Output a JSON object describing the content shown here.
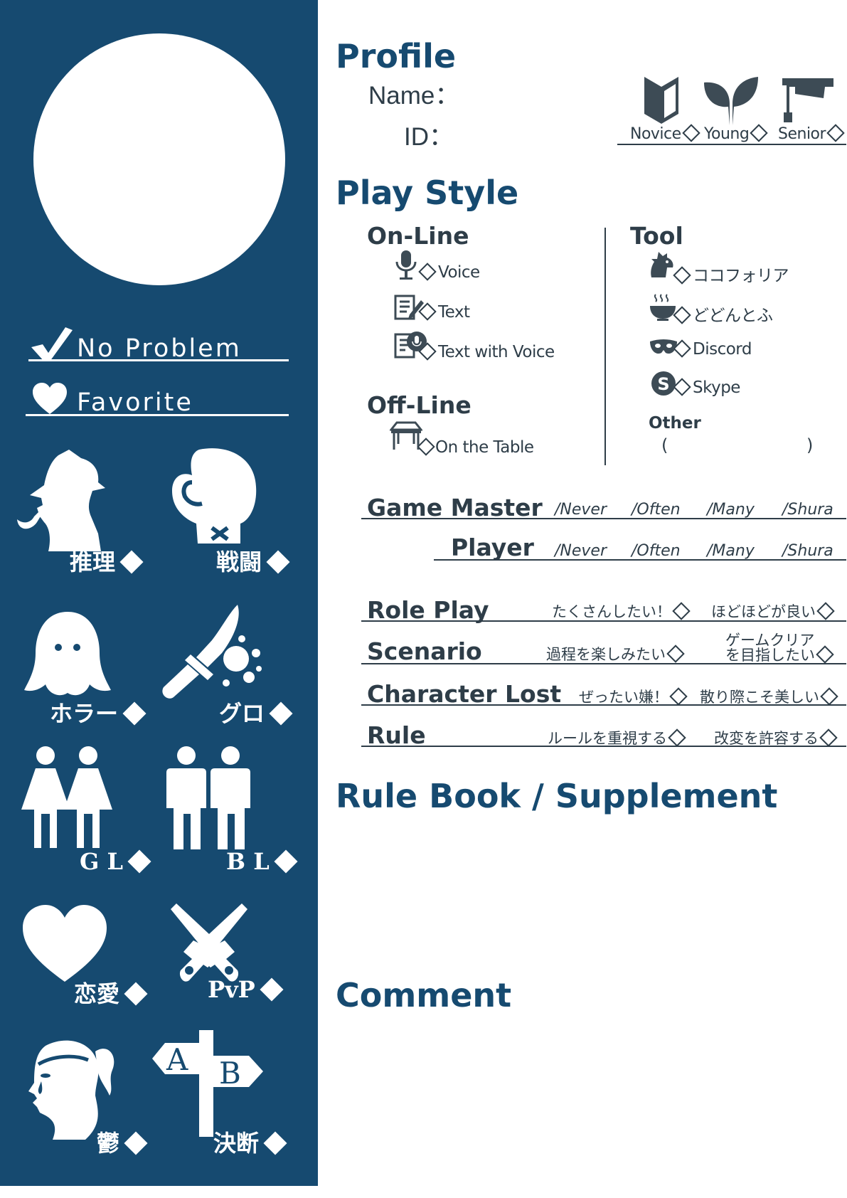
{
  "sidebar": {
    "no_problem": "No Problem",
    "favorite": "Favorite",
    "genres": [
      {
        "label": "推理",
        "icon": "detective-icon"
      },
      {
        "label": "戦闘",
        "icon": "boxing-glove-icon"
      },
      {
        "label": "ホラー",
        "icon": "ghost-icon"
      },
      {
        "label": "グロ",
        "icon": "bloody-knife-icon"
      },
      {
        "label": "G L",
        "icon": "two-women-icon"
      },
      {
        "label": "B L",
        "icon": "two-men-icon"
      },
      {
        "label": "恋愛",
        "icon": "heart-icon"
      },
      {
        "label": "PvP",
        "icon": "crossed-pistols-icon"
      },
      {
        "label": "鬱",
        "icon": "crying-woman-icon"
      },
      {
        "label": "決断",
        "icon": "signpost-icon"
      }
    ],
    "signpost_a": "A",
    "signpost_b": "B"
  },
  "profile": {
    "heading": "Profile",
    "name_label": "Name：",
    "id_label": "ID：",
    "levels": [
      {
        "label": "Novice",
        "icon": "beginner-mark-icon"
      },
      {
        "label": "Young",
        "icon": "sprout-icon"
      },
      {
        "label": "Senior",
        "icon": "graduation-cap-icon"
      }
    ]
  },
  "play_style": {
    "heading": "Play Style",
    "online_heading": "On-Line",
    "online_options": [
      {
        "label": "Voice",
        "icon": "microphone-icon"
      },
      {
        "label": "Text",
        "icon": "notepad-icon"
      },
      {
        "label": "Text with Voice",
        "icon": "notepad-mic-icon"
      }
    ],
    "offline_heading": "Off-Line",
    "offline_options": [
      {
        "label": "On the Table",
        "icon": "table-icon"
      }
    ],
    "tool_heading": "Tool",
    "tools": [
      {
        "label": "ココフォリア",
        "icon": "cockatoo-icon"
      },
      {
        "label": "どどんとふ",
        "icon": "rice-bowl-icon"
      },
      {
        "label": "Discord",
        "icon": "discord-icon"
      },
      {
        "label": "Skype",
        "icon": "skype-icon"
      }
    ],
    "other_label": "Other",
    "other_open": "(",
    "other_close": ")"
  },
  "frequency": {
    "scale": [
      "/Never",
      "/Often",
      "/Many",
      "/Shura"
    ],
    "rows": [
      {
        "label": "Game Master"
      },
      {
        "label": "Player"
      }
    ]
  },
  "preferences": [
    {
      "label": "Role Play",
      "left": "たくさんしたい！",
      "right": "ほどほどが良い"
    },
    {
      "label": "Scenario",
      "left": "過程を楽しみたい",
      "right_line1": "ゲームクリア",
      "right_line2": "を目指したい"
    },
    {
      "label": "Character Lost",
      "left": "ぜったい嫌！",
      "right": "散り際こそ美しい"
    },
    {
      "label": "Rule",
      "left": "ルールを重視する",
      "right": "改変を許容する"
    }
  ],
  "rulebook_heading": "Rule Book / Supplement",
  "comment_heading": "Comment",
  "colors": {
    "navy": "#164a70",
    "text": "#2e3d48",
    "white": "#ffffff"
  }
}
